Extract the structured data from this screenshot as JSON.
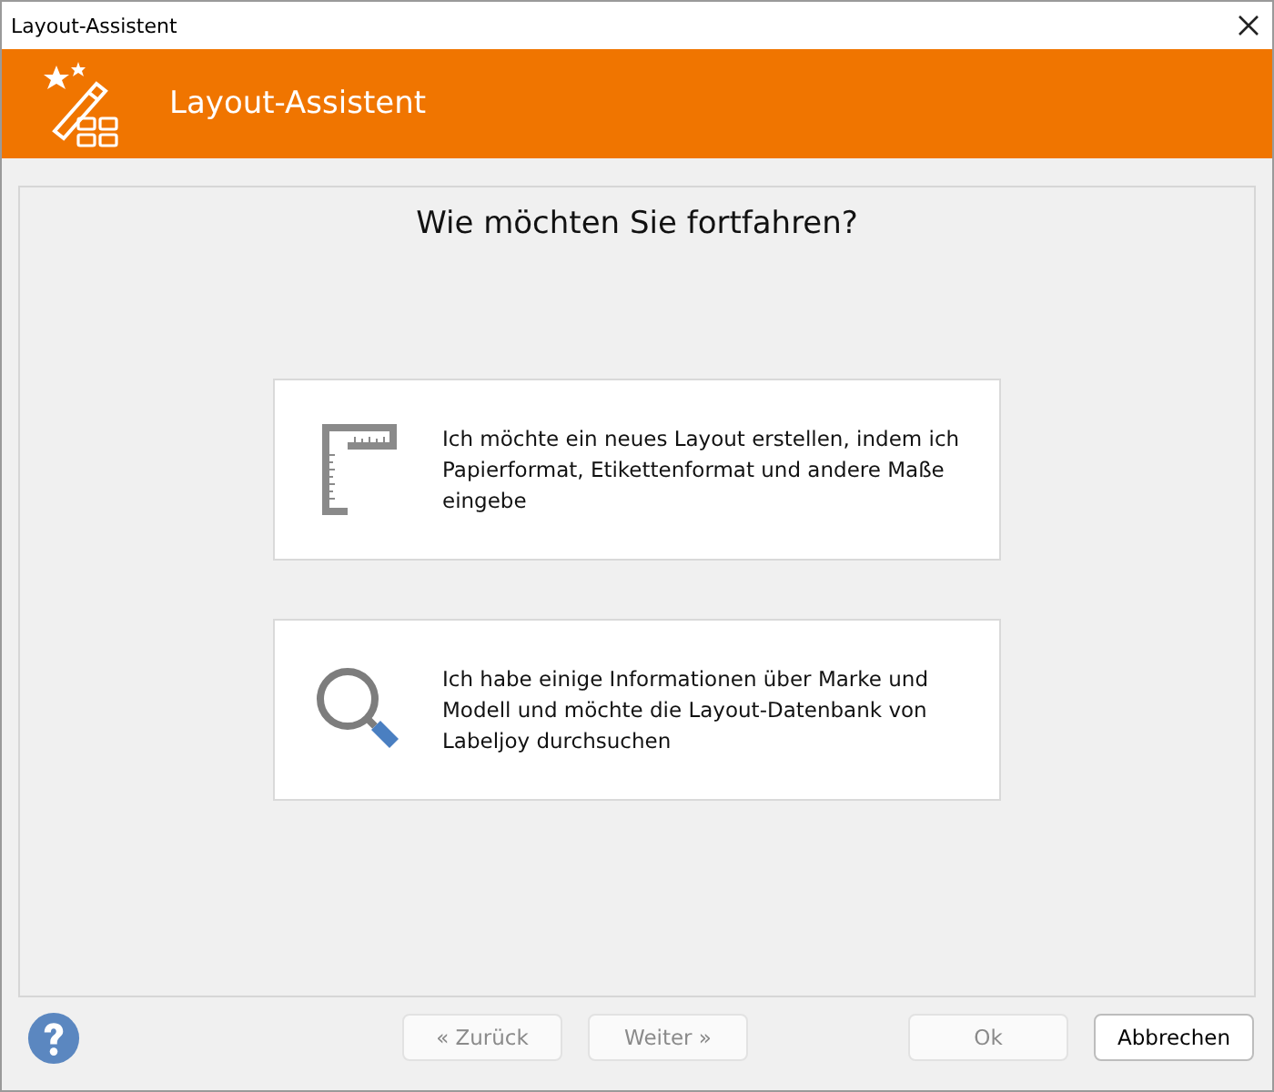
{
  "window": {
    "title": "Layout-Assistent"
  },
  "header": {
    "title": "Layout-Assistent"
  },
  "question": "Wie möchten Sie fortfahren?",
  "options": [
    {
      "kind": "ruler",
      "text": "Ich möchte ein neues Layout erstellen, indem ich Papierformat, Etikettenformat und andere Maße eingebe"
    },
    {
      "kind": "search",
      "text": "Ich habe einige Informationen über Marke und Modell und möchte die Layout-Datenbank von Labeljoy durchsuchen"
    }
  ],
  "buttons": [
    {
      "label": "« Zurück",
      "disabled": true
    },
    {
      "label": "Weiter »",
      "disabled": true
    },
    {
      "label": "Ok",
      "disabled": true
    },
    {
      "label": "Abbrechen",
      "disabled": false
    }
  ]
}
